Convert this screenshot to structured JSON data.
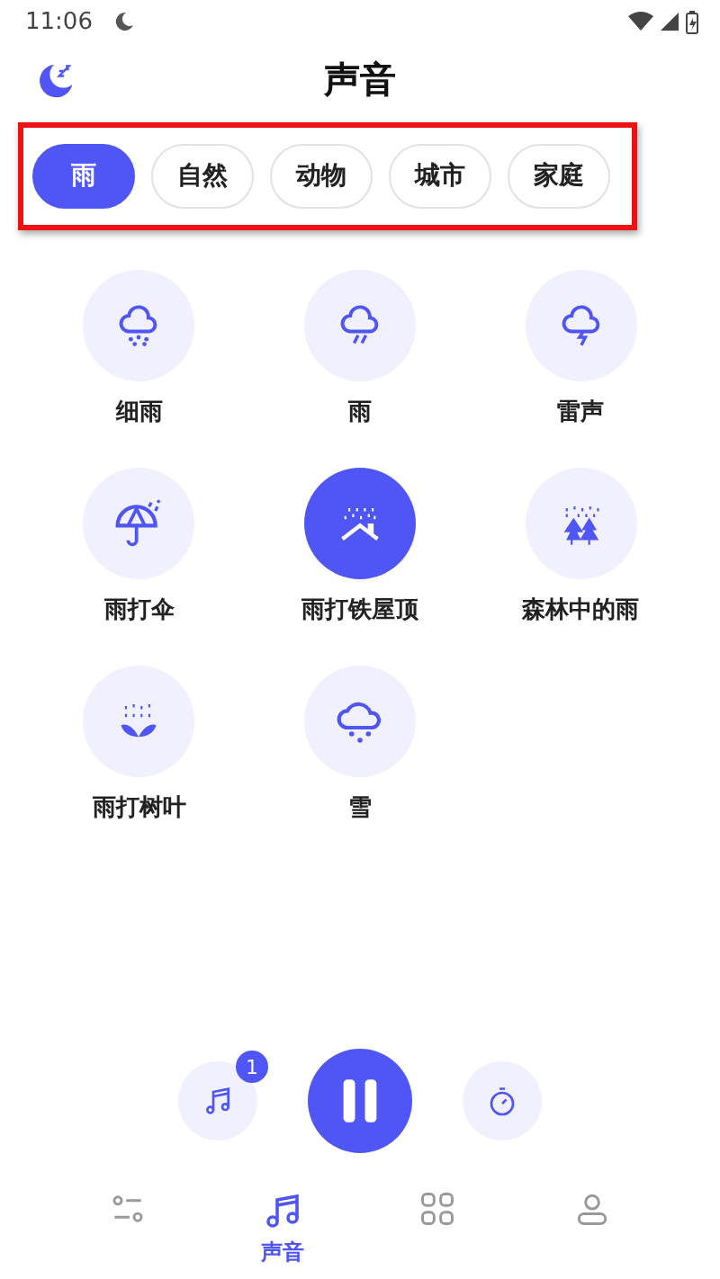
{
  "status_bar": {
    "time": "11:06"
  },
  "header": {
    "title": "声音"
  },
  "tabs": [
    {
      "label": "雨",
      "selected": true
    },
    {
      "label": "自然",
      "selected": false
    },
    {
      "label": "动物",
      "selected": false
    },
    {
      "label": "城市",
      "selected": false
    },
    {
      "label": "家庭",
      "selected": false
    }
  ],
  "sounds": [
    {
      "label": "细雨",
      "kind": "drizzle",
      "selected": false
    },
    {
      "label": "雨",
      "kind": "rain",
      "selected": false
    },
    {
      "label": "雷声",
      "kind": "thunder",
      "selected": false
    },
    {
      "label": "雨打伞",
      "kind": "umbrella",
      "selected": false
    },
    {
      "label": "雨打铁屋顶",
      "kind": "roof",
      "selected": true
    },
    {
      "label": "森林中的雨",
      "kind": "forest",
      "selected": false
    },
    {
      "label": "雨打树叶",
      "kind": "leaf",
      "selected": false
    },
    {
      "label": "雪",
      "kind": "snow",
      "selected": false
    }
  ],
  "player": {
    "playlist_badge": "1"
  },
  "nav": [
    {
      "kind": "mixer",
      "selected": false
    },
    {
      "kind": "music",
      "label": "声音",
      "selected": true
    },
    {
      "kind": "grid",
      "selected": false
    },
    {
      "kind": "profile",
      "selected": false
    }
  ]
}
